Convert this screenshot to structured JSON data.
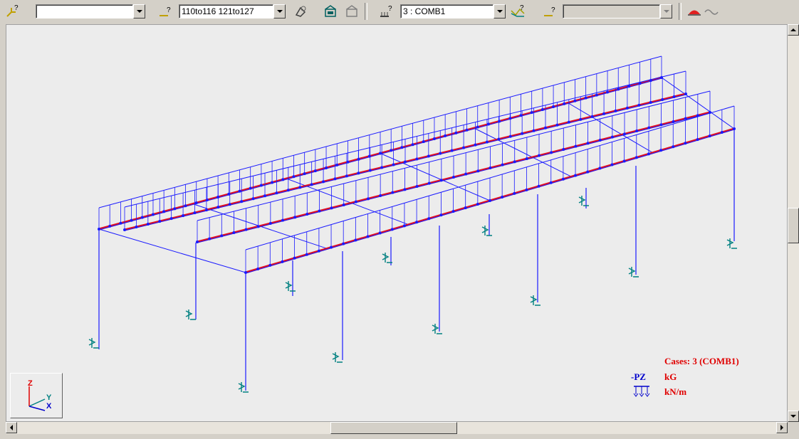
{
  "toolbar": {
    "selection_combo": {
      "value": ""
    },
    "bars_combo": {
      "value": "110to116 121to127"
    },
    "case_combo": {
      "value": "3 : COMB1"
    },
    "third_combo": {
      "value": ""
    },
    "icons": [
      "select-cursor-icon",
      "element-selection-icon",
      "eraser-icon",
      "frame-view-icon",
      "frame-outline-icon",
      "load-case-icon",
      "load-display-icon",
      "mode-selection-icon",
      "load-diagram-icon",
      "deformation-icon"
    ]
  },
  "legend": {
    "cases": "Cases: 3 (COMB1)",
    "direction": "-PZ",
    "unit_force": "kG",
    "unit_distributed": "kN/m"
  },
  "axes": {
    "z": "Z",
    "y": "Y",
    "x": "X"
  },
  "colors": {
    "structure": "#1a1aff",
    "load_line": "#e01020",
    "support": "#008080",
    "legend_text": "#e00000",
    "legend_dir": "#0000cc"
  }
}
